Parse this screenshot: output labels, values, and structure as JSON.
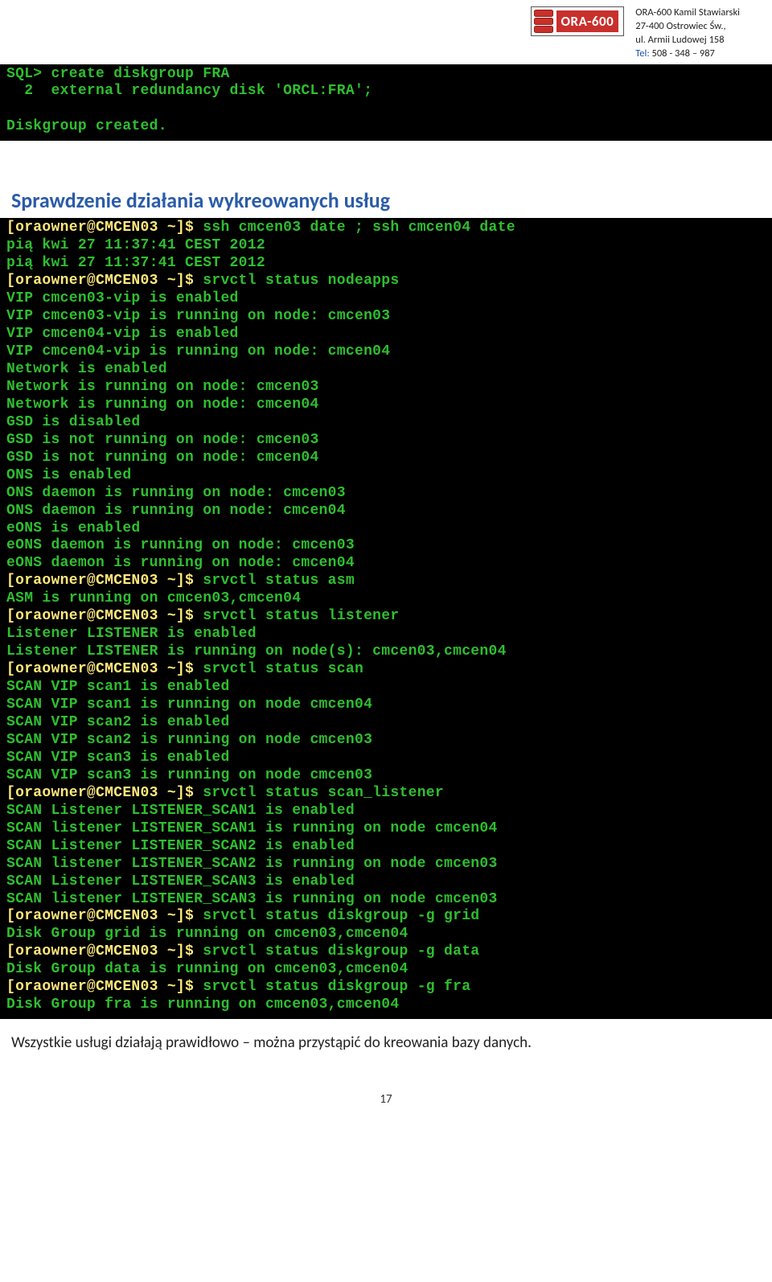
{
  "header": {
    "company_name": "ORA-600 Kamil Stawiarski",
    "address1": "27-400 Ostrowiec Św.,",
    "address2": "ul. Armii Ludowej 158",
    "tel_label": "Tel:",
    "tel_value": " 508 - 348 – 987",
    "logo_text": "ORA-600"
  },
  "terminal1": {
    "l1": "SQL> create diskgroup FRA",
    "l2": "  2  external redundancy disk 'ORCL:FRA';",
    "l3": "",
    "l4": "Diskgroup created."
  },
  "section_title": "Sprawdzenie działania wykreowanych usług",
  "terminal2": {
    "l1a": "[oraowner@CMCEN03 ~]$ ",
    "l1b": "ssh cmcen03 date ; ssh cmcen04 date",
    "l2": "pią kwi 27 11:37:41 CEST 2012",
    "l3": "pią kwi 27 11:37:41 CEST 2012",
    "l4a": "[oraowner@CMCEN03 ~]$ ",
    "l4b": "srvctl status nodeapps",
    "l5": "VIP cmcen03-vip is enabled",
    "l6": "VIP cmcen03-vip is running on node: cmcen03",
    "l7": "VIP cmcen04-vip is enabled",
    "l8": "VIP cmcen04-vip is running on node: cmcen04",
    "l9": "Network is enabled",
    "l10": "Network is running on node: cmcen03",
    "l11": "Network is running on node: cmcen04",
    "l12": "GSD is disabled",
    "l13": "GSD is not running on node: cmcen03",
    "l14": "GSD is not running on node: cmcen04",
    "l15": "ONS is enabled",
    "l16": "ONS daemon is running on node: cmcen03",
    "l17": "ONS daemon is running on node: cmcen04",
    "l18": "eONS is enabled",
    "l19": "eONS daemon is running on node: cmcen03",
    "l20": "eONS daemon is running on node: cmcen04",
    "l21a": "[oraowner@CMCEN03 ~]$ ",
    "l21b": "srvctl status asm",
    "l22": "ASM is running on cmcen03,cmcen04",
    "l23a": "[oraowner@CMCEN03 ~]$ ",
    "l23b": "srvctl status listener",
    "l24": "Listener LISTENER is enabled",
    "l25": "Listener LISTENER is running on node(s): cmcen03,cmcen04",
    "l26a": "[oraowner@CMCEN03 ~]$ ",
    "l26b": "srvctl status scan",
    "l27": "SCAN VIP scan1 is enabled",
    "l28": "SCAN VIP scan1 is running on node cmcen04",
    "l29": "SCAN VIP scan2 is enabled",
    "l30": "SCAN VIP scan2 is running on node cmcen03",
    "l31": "SCAN VIP scan3 is enabled",
    "l32": "SCAN VIP scan3 is running on node cmcen03",
    "l33a": "[oraowner@CMCEN03 ~]$ ",
    "l33b": "srvctl status scan_listener",
    "l34": "SCAN Listener LISTENER_SCAN1 is enabled",
    "l35": "SCAN listener LISTENER_SCAN1 is running on node cmcen04",
    "l36": "SCAN Listener LISTENER_SCAN2 is enabled",
    "l37": "SCAN listener LISTENER_SCAN2 is running on node cmcen03",
    "l38": "SCAN Listener LISTENER_SCAN3 is enabled",
    "l39": "SCAN listener LISTENER_SCAN3 is running on node cmcen03",
    "l40a": "[oraowner@CMCEN03 ~]$ ",
    "l40b": "srvctl status diskgroup -g grid",
    "l41": "Disk Group grid is running on cmcen03,cmcen04",
    "l42a": "[oraowner@CMCEN03 ~]$ ",
    "l42b": "srvctl status diskgroup -g data",
    "l43": "Disk Group data is running on cmcen03,cmcen04",
    "l44a": "[oraowner@CMCEN03 ~]$ ",
    "l44b": "srvctl status diskgroup -g fra",
    "l45": "Disk Group fra is running on cmcen03,cmcen04"
  },
  "body_text": "Wszystkie usługi działają prawidłowo – można przystąpić do kreowania bazy danych.",
  "page_number": "17"
}
